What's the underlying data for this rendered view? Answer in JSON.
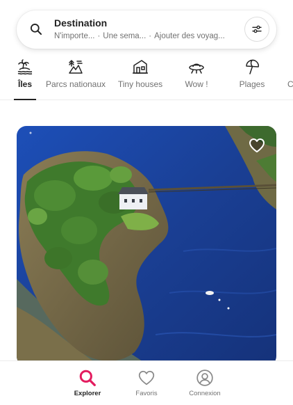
{
  "search": {
    "title": "Destination",
    "where": "N'importe...",
    "when": "Une sema...",
    "who": "Ajouter des voyag...",
    "separator": "·",
    "search_icon": "search-icon",
    "filter_icon": "sliders-icon"
  },
  "categories": [
    {
      "label": "Îles",
      "icon": "island-icon",
      "active": true
    },
    {
      "label": "Parcs nationaux",
      "icon": "national-park-icon",
      "active": false
    },
    {
      "label": "Tiny houses",
      "icon": "tiny-house-icon",
      "active": false
    },
    {
      "label": "Wow !",
      "icon": "ufo-icon",
      "active": false
    },
    {
      "label": "Plages",
      "icon": "beach-umbrella-icon",
      "active": false
    },
    {
      "label": "C",
      "icon": "",
      "active": false
    }
  ],
  "listing": {
    "photo": "aerial-island-house-photo",
    "favorite_icon": "heart-icon"
  },
  "bottom_nav": [
    {
      "label": "Explorer",
      "icon": "search-icon",
      "active": true
    },
    {
      "label": "Favoris",
      "icon": "heart-icon",
      "active": false
    },
    {
      "label": "Connexion",
      "icon": "user-circle-icon",
      "active": false
    }
  ],
  "colors": {
    "accent": "#E31C5F",
    "text": "#222222",
    "muted": "#717171",
    "border": "#EBEBEB"
  }
}
